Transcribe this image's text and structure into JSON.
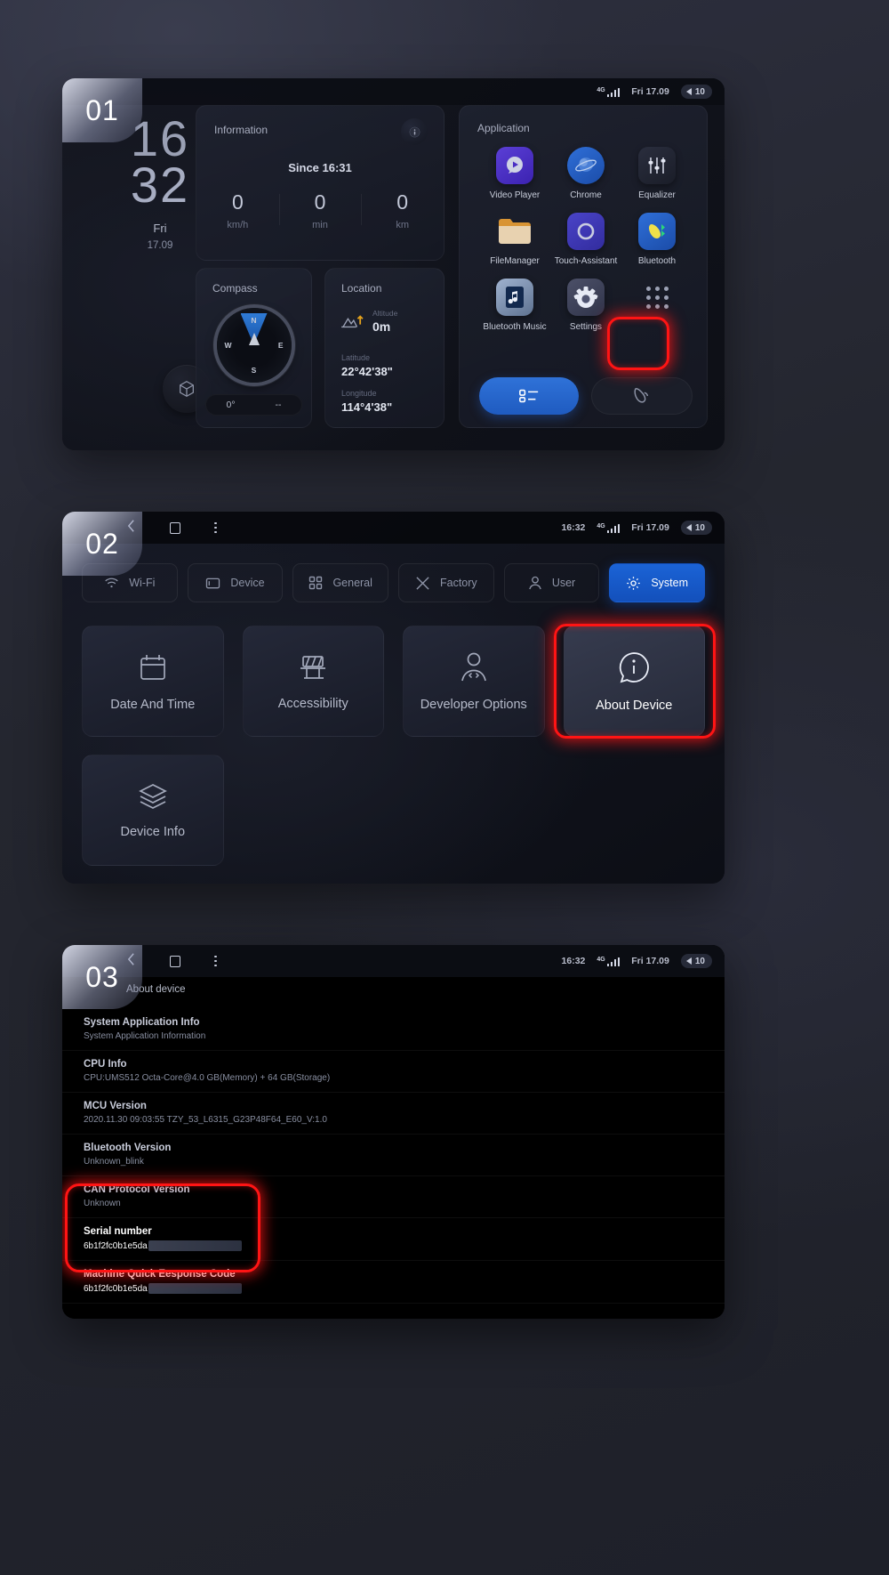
{
  "steps": {
    "one": "01",
    "two": "02",
    "three": "03"
  },
  "panel1": {
    "statusbar": {
      "network": "4G",
      "datetime": "Fri 17.09",
      "volume": "10"
    },
    "clock": {
      "hours": "16",
      "minutes": "32",
      "day": "Fri",
      "date": "17.09"
    },
    "information": {
      "title": "Information",
      "since": "Since 16:31",
      "stats": [
        {
          "value": "0",
          "unit": "km/h"
        },
        {
          "value": "0",
          "unit": "min"
        },
        {
          "value": "0",
          "unit": "km"
        }
      ]
    },
    "compass": {
      "title": "Compass",
      "north": "N",
      "south": "S",
      "west": "W",
      "east": "E",
      "degrees": "0°",
      "direction": "--"
    },
    "location": {
      "title": "Location",
      "altitude_label": "Altitude",
      "altitude_value": "0m",
      "latitude_label": "Latitude",
      "latitude_value": "22°42'38\"",
      "longitude_label": "Longitude",
      "longitude_value": "114°4'38\""
    },
    "application": {
      "title": "Application",
      "apps": [
        {
          "label": "Video Player",
          "icon": "video-player-icon"
        },
        {
          "label": "Chrome",
          "icon": "chrome-icon"
        },
        {
          "label": "Equalizer",
          "icon": "equalizer-icon"
        },
        {
          "label": "FileManager",
          "icon": "folder-icon"
        },
        {
          "label": "Touch-Assistant",
          "icon": "touch-assistant-icon"
        },
        {
          "label": "Bluetooth",
          "icon": "bluetooth-phone-icon"
        },
        {
          "label": "Bluetooth Music",
          "icon": "music-icon"
        },
        {
          "label": "Settings",
          "icon": "gear-icon"
        },
        {
          "label": "",
          "icon": "app-drawer-icon"
        }
      ]
    }
  },
  "panel2": {
    "statusbar": {
      "time": "16:32",
      "network": "4G",
      "datetime": "Fri 17.09",
      "volume": "10"
    },
    "tabs": [
      {
        "label": "Wi-Fi",
        "icon": "wifi-icon",
        "active": false
      },
      {
        "label": "Device",
        "icon": "device-icon",
        "active": false
      },
      {
        "label": "General",
        "icon": "grid-icon",
        "active": false
      },
      {
        "label": "Factory",
        "icon": "tools-icon",
        "active": false
      },
      {
        "label": "User",
        "icon": "user-icon",
        "active": false
      },
      {
        "label": "System",
        "icon": "gear-icon",
        "active": true
      }
    ],
    "tiles": [
      {
        "label": "Date And Time",
        "icon": "calendar-icon",
        "selected": false
      },
      {
        "label": "Accessibility",
        "icon": "accessibility-icon",
        "selected": false
      },
      {
        "label": "Developer Options",
        "icon": "developer-icon",
        "selected": false
      },
      {
        "label": "About Device",
        "icon": "info-icon",
        "selected": true
      },
      {
        "label": "Device Info",
        "icon": "layers-icon",
        "selected": false
      }
    ]
  },
  "panel3": {
    "statusbar": {
      "time": "16:32",
      "network": "4G",
      "datetime": "Fri 17.09",
      "volume": "10"
    },
    "title": "About device",
    "rows": [
      {
        "title": "System Application Info",
        "subtitle": "System Application Information",
        "redacted": false,
        "highlight": false
      },
      {
        "title": "CPU Info",
        "subtitle": "CPU:UMS512 Octa-Core@4.0 GB(Memory) + 64 GB(Storage)",
        "redacted": false,
        "highlight": false
      },
      {
        "title": "MCU Version",
        "subtitle": "2020.11.30 09:03:55 TZY_53_L6315_G23P48F64_E60_V:1.0",
        "redacted": false,
        "highlight": false
      },
      {
        "title": "Bluetooth Version",
        "subtitle": "Unknown_blink",
        "redacted": false,
        "highlight": false
      },
      {
        "title": "CAN Protocol Version",
        "subtitle": "Unknown",
        "redacted": false,
        "highlight": false
      },
      {
        "title": "Serial number",
        "subtitle": "6b1f2fc0b1e5da",
        "redacted": true,
        "highlight": true
      },
      {
        "title": "Machine Quick Eesponse Code",
        "subtitle": "6b1f2fc0b1e5da",
        "redacted": true,
        "highlight": true
      }
    ]
  },
  "colors": {
    "accent": "#1b63d6",
    "highlight": "#ff1414",
    "panel_bg": "#0e1018"
  }
}
